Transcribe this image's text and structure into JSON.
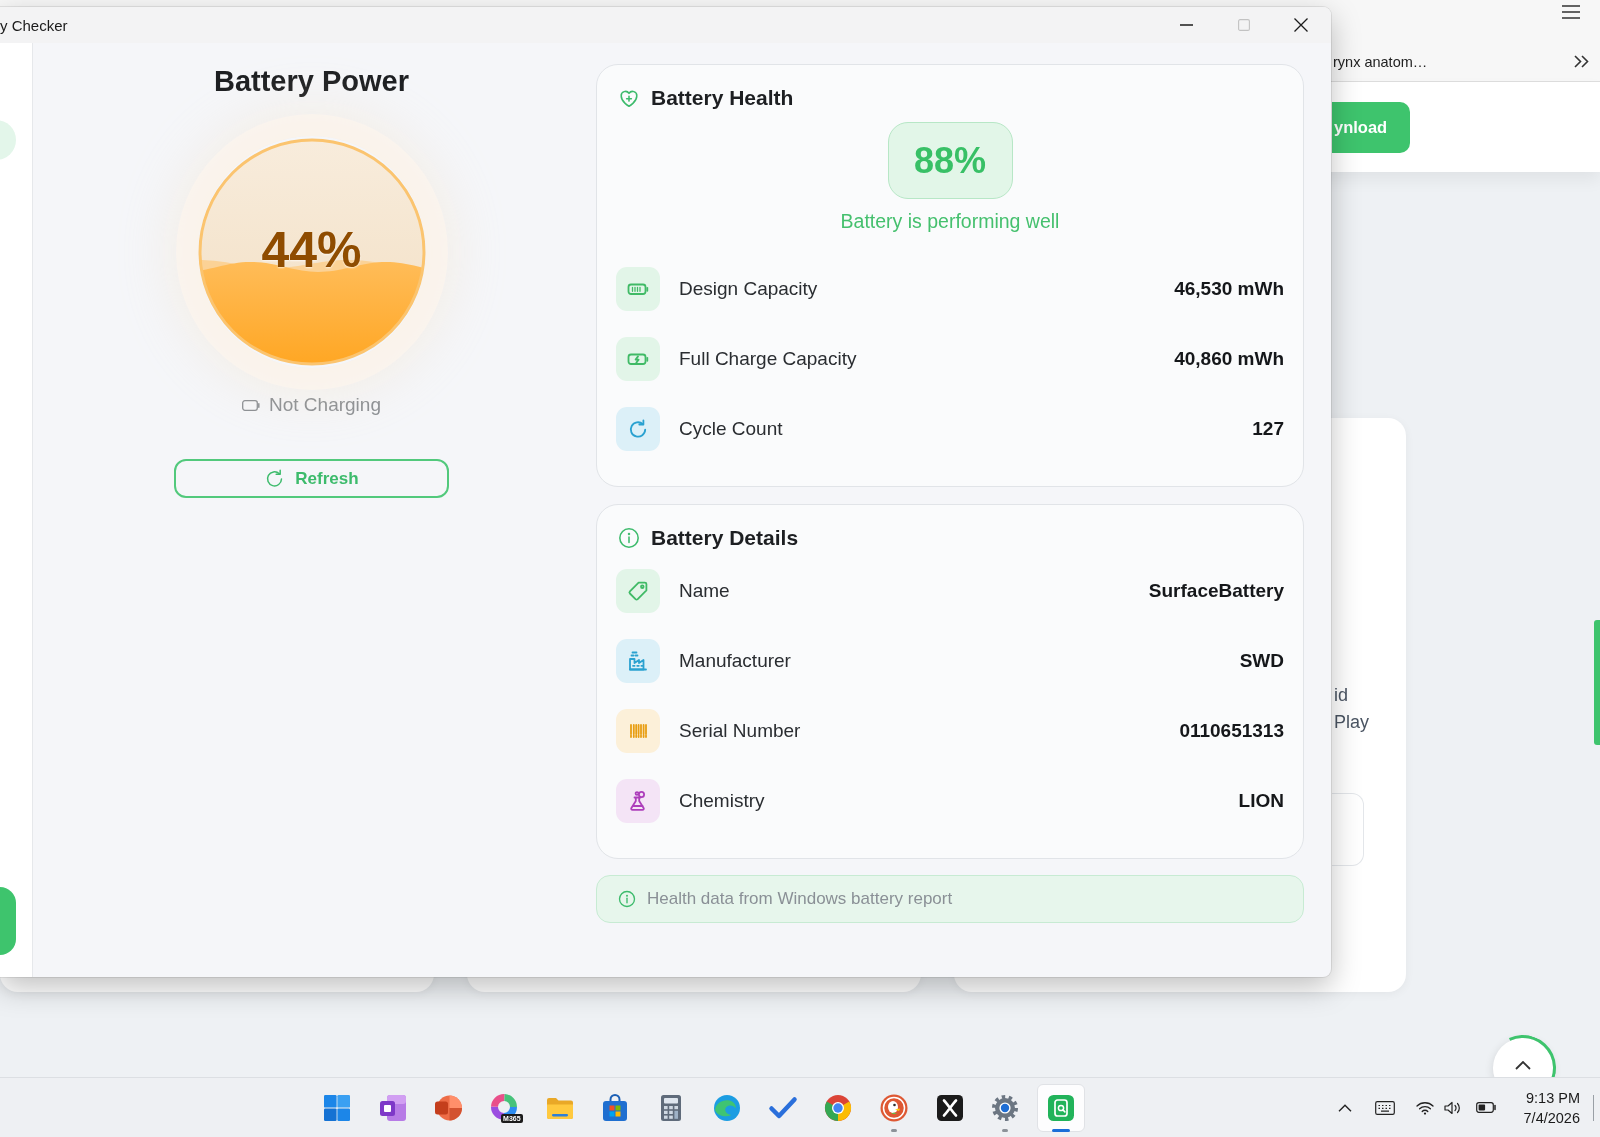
{
  "browser": {
    "tab_title": "rynx anatom…",
    "header_button": "ynload",
    "card_lines": [
      "id",
      "Play"
    ]
  },
  "window": {
    "title": "y Checker",
    "controls": [
      {
        "kind": "minimize",
        "disabled": false
      },
      {
        "kind": "maximize",
        "disabled": true
      },
      {
        "kind": "close",
        "disabled": false
      }
    ]
  },
  "battery_power": {
    "title": "Battery Power",
    "percent": "44%",
    "level": 0.44,
    "status": "Not Charging",
    "refresh_button": "Refresh"
  },
  "battery_health": {
    "title": "Battery Health",
    "health": "88%",
    "message": "Battery is performing well",
    "rows": [
      {
        "kind": "battery",
        "label": "Design Capacity",
        "value": "46,530 mWh",
        "color": "#e2f5e8"
      },
      {
        "kind": "battery_bolt",
        "label": "Full Charge Capacity",
        "value": "40,860 mWh",
        "color": "#e2f5e8"
      },
      {
        "kind": "cycle",
        "label": "Cycle Count",
        "value": "127",
        "color": "#dcf0f8"
      }
    ]
  },
  "battery_details": {
    "title": "Battery Details",
    "rows": [
      {
        "kind": "tag",
        "label": "Name",
        "value": "SurfaceBattery",
        "color": "#e2f5e8"
      },
      {
        "kind": "factory",
        "label": "Manufacturer",
        "value": "SWD",
        "color": "#dcf0f8"
      },
      {
        "kind": "barcode",
        "label": "Serial Number",
        "value": "0110651313",
        "color": "#fcf0d9"
      },
      {
        "kind": "flask",
        "label": "Chemistry",
        "value": "LION",
        "color": "#f4e4f6"
      }
    ]
  },
  "note": "Health data from Windows battery report",
  "taskbar": {
    "apps": [
      {
        "kind": "start",
        "running": false,
        "selected": false
      },
      {
        "kind": "notes",
        "running": false,
        "selected": false
      },
      {
        "kind": "slides",
        "running": false,
        "selected": false
      },
      {
        "kind": "suite",
        "badge": "M365",
        "running": false,
        "selected": false
      },
      {
        "kind": "folder",
        "running": false,
        "selected": false
      },
      {
        "kind": "store",
        "running": false,
        "selected": false
      },
      {
        "kind": "calculator",
        "running": false,
        "selected": false
      },
      {
        "kind": "swirl",
        "running": false,
        "selected": false
      },
      {
        "kind": "check",
        "running": false,
        "selected": false
      },
      {
        "kind": "tricolor",
        "running": false,
        "selected": false
      },
      {
        "kind": "duck",
        "running": true,
        "selected": false
      },
      {
        "kind": "xtile",
        "running": false,
        "selected": false
      },
      {
        "kind": "gear",
        "running": true,
        "selected": false
      },
      {
        "kind": "battery_app",
        "running": true,
        "selected": true
      }
    ],
    "time": "9:13 PM",
    "date": "7/4/2026"
  }
}
